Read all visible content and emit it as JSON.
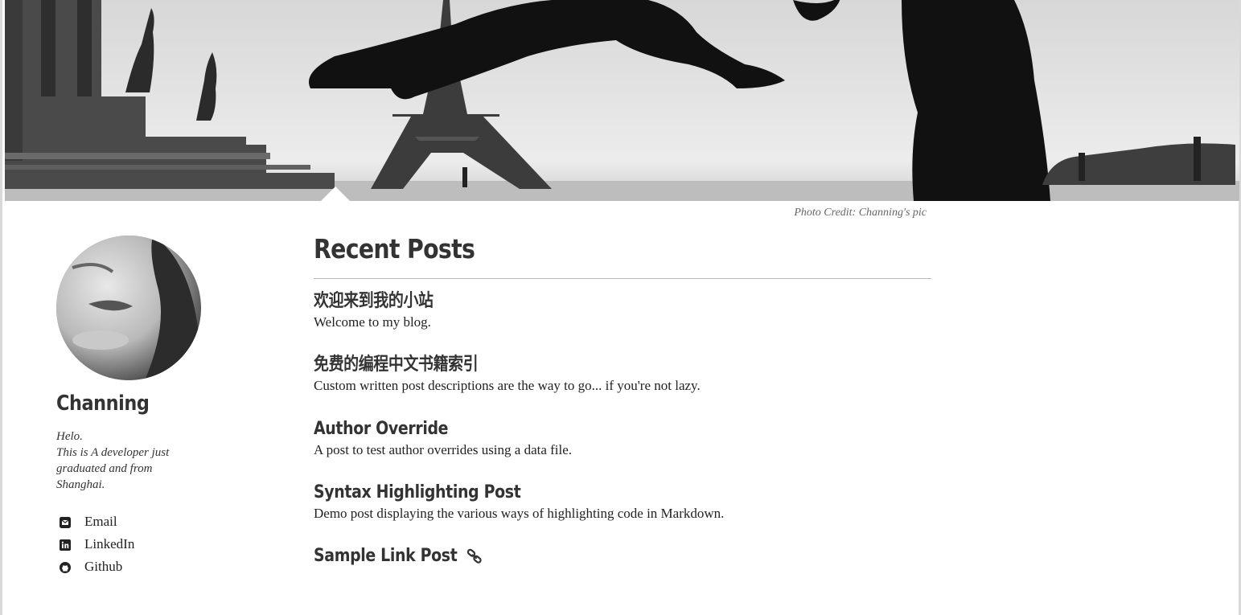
{
  "hero": {
    "image": "paris-eiffel-tower-jump-photo",
    "credit": "Photo Credit: Channing's pic"
  },
  "author": {
    "name": "Channing",
    "bio_lines": [
      "Helo.",
      "This is A developer just graduated and from Shanghai."
    ],
    "avatar": "portrait-photo"
  },
  "social": [
    {
      "label": "Email",
      "icon": "envelope-icon"
    },
    {
      "label": "LinkedIn",
      "icon": "linkedin-icon"
    },
    {
      "label": "Github",
      "icon": "github-icon"
    }
  ],
  "main": {
    "title": "Recent Posts",
    "posts": [
      {
        "title": "欢迎来到我的小站",
        "description": "Welcome to my blog."
      },
      {
        "title": "免费的编程中文书籍索引",
        "description": "Custom written post descriptions are the way to go... if you're not lazy."
      },
      {
        "title": "Author Override",
        "description": "A post to test author overrides using a data file."
      },
      {
        "title": "Syntax Highlighting Post",
        "description": "Demo post displaying the various ways of highlighting code in Markdown."
      },
      {
        "title": "Sample Link Post",
        "description": "",
        "icon": "link-icon"
      }
    ]
  },
  "colors": {
    "text": "#222222",
    "heading": "#333333",
    "muted": "#666666",
    "divider": "#bbbbbb"
  }
}
